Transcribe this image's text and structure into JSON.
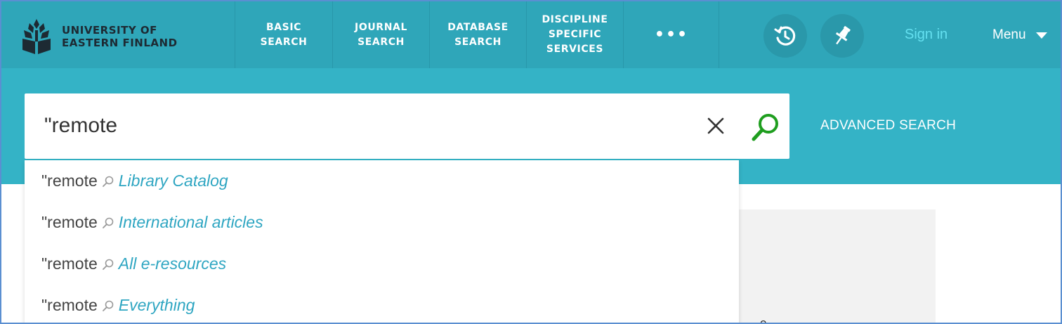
{
  "logo": {
    "line1": "UNIVERSITY OF",
    "line2": "EASTERN FINLAND"
  },
  "nav": {
    "items": [
      {
        "label": "BASIC\nSEARCH"
      },
      {
        "label": "JOURNAL\nSEARCH"
      },
      {
        "label": "DATABASE\nSEARCH"
      },
      {
        "label": "DISCIPLINE\nSPECIFIC\nSERVICES"
      },
      {
        "label": "•••"
      }
    ],
    "sign_in": "Sign in",
    "menu": "Menu"
  },
  "icons": {
    "logo": "uef-logo-icon",
    "history": "history-icon",
    "pin": "pin-icon",
    "clear": "close-icon",
    "search": "search-icon",
    "suggestion": "magnifier-icon",
    "menu_caret": "caret-down-icon"
  },
  "search": {
    "value": "\"remote",
    "advanced": "ADVANCED SEARCH"
  },
  "suggestions": [
    {
      "query": "\"remote",
      "scope": "Library Catalog"
    },
    {
      "query": "\"remote",
      "scope": "International articles"
    },
    {
      "query": "\"remote",
      "scope": "All e-resources"
    },
    {
      "query": "\"remote",
      "scope": "Everything"
    }
  ],
  "background_text": "e",
  "colors": {
    "topbar": "#2fa6b9",
    "searchband": "#34b3c6",
    "sign_in": "#64e0f0",
    "scope_text": "#2fa6c2",
    "search_icon": "#1f9e1f"
  }
}
